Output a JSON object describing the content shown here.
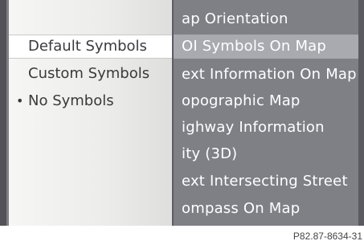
{
  "main_menu": {
    "items": [
      {
        "label": "ap Orientation"
      },
      {
        "label": "OI Symbols On Map"
      },
      {
        "label": "ext Information On Map"
      },
      {
        "label": "opographic Map"
      },
      {
        "label": "ighway Information"
      },
      {
        "label": "ity (3D)"
      },
      {
        "label": "ext Intersecting Street"
      },
      {
        "label": "ompass On Map"
      }
    ]
  },
  "submenu": {
    "items": [
      {
        "label": "Default Symbols",
        "highlighted": true
      },
      {
        "label": "Custom Symbols"
      },
      {
        "label": "No Symbols",
        "bullet": "•",
        "active": true
      }
    ]
  },
  "figure_code": "P82.87-8634-31"
}
